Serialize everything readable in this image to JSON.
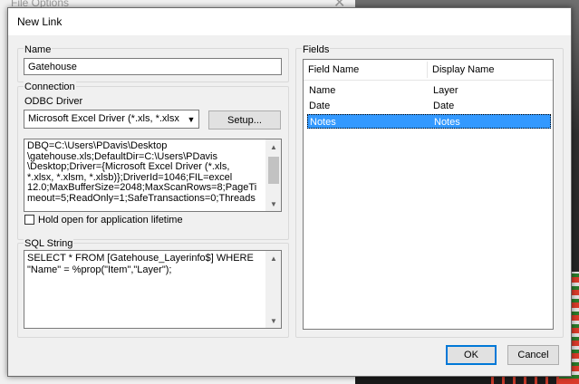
{
  "background_window": {
    "title": "File Options"
  },
  "dialog": {
    "title": "New Link",
    "name_group": {
      "label": "Name",
      "value": "Gatehouse"
    },
    "connection_group": {
      "label": "Connection",
      "odbc_label": "ODBC Driver",
      "driver_selected": "Microsoft Excel Driver (*.xls, *.xlsx",
      "setup_button": "Setup...",
      "connection_string": "DBQ=C:\\Users\\PDavis\\Desktop\n\\gatehouse.xls;DefaultDir=C:\\Users\\PDavis\n\\Desktop;Driver={Microsoft Excel Driver (*.xls,\n*.xlsx, *.xlsm, *.xlsb)};DriverId=1046;FIL=excel\n12.0;MaxBufferSize=2048;MaxScanRows=8;PageTi\nmeout=5;ReadOnly=1;SafeTransactions=0;Threads",
      "hold_open_label": "Hold open for application lifetime",
      "hold_open_checked": false
    },
    "sql_group": {
      "label": "SQL String",
      "query": "SELECT * FROM [Gatehouse_Layerinfo$] WHERE\n\"Name\" = %prop(\"Item\",\"Layer\");"
    },
    "fields_group": {
      "label": "Fields",
      "columns": [
        "Field Name",
        "Display Name"
      ],
      "rows": [
        {
          "field": "Name",
          "display": "Layer",
          "selected": false
        },
        {
          "field": "Date",
          "display": "Date",
          "selected": false
        },
        {
          "field": "Notes",
          "display": "Notes",
          "selected": true
        }
      ]
    },
    "ok_button": "OK",
    "cancel_button": "Cancel"
  },
  "colors": {
    "selection": "#3399ff",
    "default_button_border": "#0078d7"
  }
}
